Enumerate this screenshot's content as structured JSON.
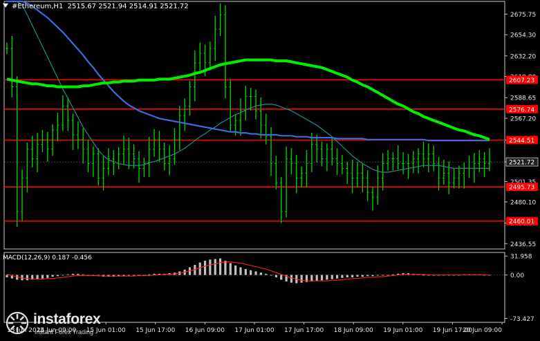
{
  "header": {
    "symbol": "#Ethereum",
    "timeframe": "H1",
    "ohlc": "2515.67 2521.94 2514.91 2521.72"
  },
  "macd": {
    "label": "MACD(12,26,9) 0.187 -0.456",
    "scale": [
      "31.958",
      "0.00",
      "-73.427"
    ]
  },
  "brand": {
    "name": "instaforex",
    "tagline": "Instant Forex Trading"
  },
  "colors": {
    "background": "#000000",
    "candle": "#00cc00",
    "ma_fast": "#1f8f8f",
    "ma_mid": "#4169e1",
    "ma_slow": "#00ee00",
    "level_line": "#ff0000",
    "level_label_bg": "#ff0000",
    "signal_line": "#ff2020",
    "histogram": "#c0c0c0"
  },
  "chart_data": {
    "type": "line",
    "title": "#Ethereum,H1",
    "ylim": [
      2431,
      2689
    ],
    "y_ticks": [
      "2675.75",
      "2654.30",
      "2632.20",
      "2610.80",
      "2588.65",
      "2567.20",
      "2544.51",
      "2521.72",
      "2501.35",
      "2480.10",
      "2458.00",
      "2436.55"
    ],
    "x_labels": [
      "13 Jun 2025",
      "14 Jun 09:00",
      "15 Jun 01:00",
      "15 Jun 17:00",
      "16 Jun 09:00",
      "17 Jun 01:00",
      "17 Jun 17:00",
      "18 Jun 09:00",
      "19 Jun 01:00",
      "19 Jun 17:00",
      "20 Jun 09:00"
    ],
    "current_price": 2521.72,
    "levels": [
      {
        "value": 2607.23,
        "label": "2607.23"
      },
      {
        "value": 2576.74,
        "label": "2576.74"
      },
      {
        "value": 2544.51,
        "label": "2544.51"
      },
      {
        "value": 2495.73,
        "label": "2495.73"
      },
      {
        "value": 2460.01,
        "label": "2460.01"
      }
    ],
    "price": [
      2640,
      2600,
      2470,
      2505,
      2535,
      2525,
      2540,
      2545,
      2535,
      2555,
      2560,
      2580,
      2565,
      2550,
      2545,
      2535,
      2520,
      2530,
      2505,
      2515,
      2525,
      2520,
      2530,
      2535,
      2530,
      2525,
      2515,
      2520,
      2535,
      2545,
      2535,
      2520,
      2525,
      2545,
      2570,
      2580,
      2600,
      2625,
      2635,
      2625,
      2640,
      2660,
      2675,
      2600,
      2560,
      2565,
      2575,
      2590,
      2590,
      2575,
      2560,
      2548,
      2520,
      2500,
      2470,
      2525,
      2520,
      2505,
      2510,
      2520,
      2540,
      2535,
      2525,
      2535,
      2525,
      2520,
      2515,
      2510,
      2505,
      2510,
      2505,
      2490,
      2485,
      2505,
      2520,
      2525,
      2525,
      2520,
      2520,
      2520,
      2525,
      2530,
      2525,
      2530,
      2520,
      2505,
      2510,
      2500,
      2505,
      2510,
      2515,
      2515,
      2520,
      2525,
      2520,
      2522
    ],
    "series": [
      {
        "values": [
          2720,
          2708,
          2695,
          2685,
          2675,
          2664,
          2653,
          2642,
          2631,
          2620,
          2609,
          2598,
          2588,
          2578,
          2568,
          2558,
          2550,
          2542,
          2534,
          2528,
          2524,
          2522,
          2520,
          2519,
          2518,
          2518,
          2518,
          2519,
          2521,
          2522,
          2524,
          2526,
          2528,
          2530,
          2533,
          2536,
          2540,
          2544,
          2548,
          2551,
          2555,
          2558,
          2562,
          2565,
          2568,
          2571,
          2573,
          2576,
          2578,
          2580,
          2581,
          2582,
          2582,
          2581,
          2579,
          2577,
          2575,
          2572,
          2569,
          2566,
          2563,
          2560,
          2556,
          2552,
          2548,
          2543,
          2538,
          2533,
          2528,
          2524,
          2520,
          2517,
          2514,
          2512,
          2511,
          2511,
          2512,
          2513,
          2514,
          2515,
          2516,
          2517,
          2518,
          2518,
          2518,
          2518,
          2517,
          2516,
          2515,
          2515,
          2515,
          2515,
          2515,
          2515,
          2515,
          2515
        ]
      },
      {
        "values": [
          2698,
          2696,
          2693,
          2690,
          2687,
          2684,
          2680,
          2676,
          2672,
          2667,
          2662,
          2657,
          2651,
          2645,
          2639,
          2633,
          2626,
          2620,
          2613,
          2607,
          2601,
          2595,
          2590,
          2585,
          2581,
          2578,
          2575,
          2573,
          2571,
          2569,
          2567,
          2566,
          2565,
          2564,
          2563,
          2562,
          2561,
          2560,
          2559,
          2558,
          2557,
          2556,
          2555,
          2554,
          2553,
          2553,
          2552,
          2552,
          2551,
          2551,
          2550,
          2550,
          2550,
          2550,
          2549,
          2549,
          2549,
          2548,
          2548,
          2548,
          2547,
          2547,
          2547,
          2547,
          2547,
          2546,
          2546,
          2546,
          2546,
          2546,
          2546,
          2545,
          2545,
          2545,
          2545,
          2545,
          2545,
          2545,
          2545,
          2545,
          2545,
          2545,
          2545,
          2544,
          2544,
          2544,
          2544,
          2544,
          2544,
          2544,
          2544,
          2544,
          2544,
          2544,
          2544,
          2544
        ]
      },
      {
        "values": [
          2608,
          2607,
          2606,
          2605,
          2604,
          2603,
          2603,
          2602,
          2601,
          2601,
          2600,
          2600,
          2600,
          2600,
          2600,
          2601,
          2601,
          2602,
          2603,
          2604,
          2604,
          2605,
          2605,
          2606,
          2606,
          2606,
          2607,
          2607,
          2607,
          2607,
          2608,
          2608,
          2608,
          2609,
          2610,
          2611,
          2612,
          2614,
          2615,
          2617,
          2619,
          2621,
          2623,
          2624,
          2625,
          2626,
          2627,
          2628,
          2628,
          2628,
          2628,
          2628,
          2628,
          2627,
          2627,
          2627,
          2626,
          2625,
          2624,
          2623,
          2622,
          2621,
          2620,
          2618,
          2616,
          2614,
          2612,
          2610,
          2607,
          2605,
          2602,
          2600,
          2597,
          2594,
          2591,
          2588,
          2585,
          2582,
          2580,
          2577,
          2574,
          2572,
          2569,
          2567,
          2565,
          2563,
          2561,
          2559,
          2557,
          2555,
          2554,
          2552,
          2550,
          2549,
          2547,
          2545
        ]
      }
    ],
    "macd": {
      "ylim": [
        -80,
        38
      ],
      "histogram": [
        -4,
        -6,
        -8,
        -9,
        -9,
        -8,
        -7,
        -6,
        -5,
        -3,
        -2,
        0,
        1,
        2,
        2,
        1,
        0,
        -1,
        -2,
        -3,
        -3,
        -3,
        -2,
        -2,
        -1,
        -1,
        0,
        0,
        1,
        2,
        2,
        2,
        3,
        4,
        6,
        9,
        13,
        17,
        21,
        24,
        26,
        27,
        28,
        24,
        20,
        16,
        13,
        10,
        8,
        6,
        4,
        2,
        -1,
        -4,
        -8,
        -11,
        -13,
        -14,
        -13,
        -12,
        -11,
        -10,
        -9,
        -8,
        -7,
        -6,
        -5,
        -4,
        -4,
        -3,
        -3,
        -2,
        -2,
        -1,
        -1,
        0,
        1,
        2,
        3,
        3,
        2,
        1,
        0,
        -1,
        -1,
        -1,
        0,
        0,
        0,
        0,
        1,
        1,
        1,
        1,
        0,
        0
      ],
      "signal": [
        1,
        -1,
        -3,
        -5,
        -6,
        -7,
        -7,
        -7,
        -6,
        -6,
        -5,
        -4,
        -3,
        -2,
        -1,
        -1,
        -1,
        -1,
        -1,
        -2,
        -2,
        -2,
        -2,
        -2,
        -2,
        -2,
        -1,
        -1,
        -1,
        0,
        0,
        1,
        1,
        2,
        3,
        5,
        7,
        9,
        12,
        15,
        17,
        19,
        21,
        22,
        22,
        21,
        20,
        18,
        16,
        14,
        12,
        10,
        7,
        4,
        1,
        -2,
        -5,
        -7,
        -9,
        -10,
        -10,
        -10,
        -10,
        -10,
        -9,
        -9,
        -8,
        -7,
        -6,
        -6,
        -5,
        -4,
        -4,
        -3,
        -3,
        -2,
        -1,
        0,
        1,
        1,
        1,
        1,
        1,
        0,
        0,
        0,
        0,
        0,
        0,
        0,
        0,
        0,
        0,
        0,
        0,
        0
      ]
    }
  }
}
